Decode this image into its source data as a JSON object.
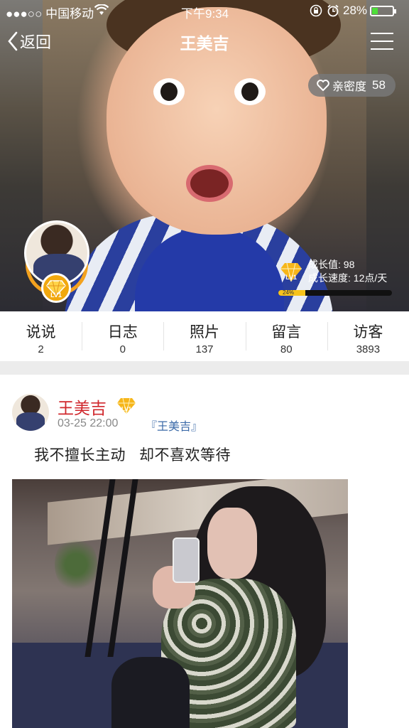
{
  "status_bar": {
    "carrier": "●●●○○ 中国移动",
    "time": "下午9:34",
    "battery_pct": "28%",
    "battery_level": 0.28,
    "battery_color": "#4ede3a"
  },
  "nav": {
    "back_label": "返回",
    "title": "王美吉"
  },
  "intimacy": {
    "label": "亲密度",
    "value": "58"
  },
  "profile": {
    "avatar_level": "LV1"
  },
  "growth": {
    "badge_level": "LV1",
    "value_label": "成长值: 98",
    "speed_label": "成长速度: 12点/天",
    "percent_text": "24%",
    "percent": 0.24,
    "bar_color": "#f7c31c"
  },
  "tabs": [
    {
      "label": "说说",
      "count": "2"
    },
    {
      "label": "日志",
      "count": "0"
    },
    {
      "label": "照片",
      "count": "137"
    },
    {
      "label": "留言",
      "count": "80"
    },
    {
      "label": "访客",
      "count": "3893"
    }
  ],
  "post": {
    "author": "王美吉",
    "badge_level": "LV1",
    "time": "03-25 22:00",
    "source": "『王美吉』",
    "text": "我不擅长主动   却不喜欢等待",
    "name_color": "#d0272c"
  },
  "icons": {
    "back": "chevron-left-icon",
    "menu": "hamburger-menu-icon",
    "heart": "heart-icon",
    "wifi": "wifi-icon",
    "lock": "rotation-lock-icon",
    "alarm": "alarm-icon",
    "diamond": "diamond-icon"
  }
}
